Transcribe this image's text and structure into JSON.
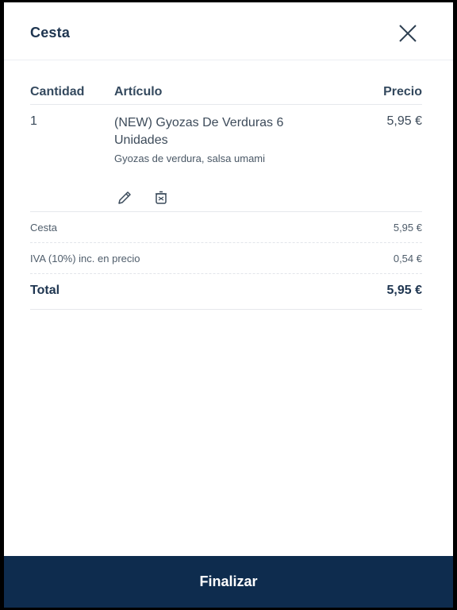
{
  "header": {
    "title": "Cesta",
    "close_icon": "close-icon"
  },
  "table": {
    "headers": {
      "qty": "Cantidad",
      "article": "Artículo",
      "price": "Precio"
    },
    "items": [
      {
        "qty": "1",
        "name": "(NEW) Gyozas De Verduras 6 Unidades",
        "description": "Gyozas de verdura, salsa umami",
        "price": "5,95 €",
        "edit_icon": "pencil-icon",
        "delete_icon": "trash-icon"
      }
    ]
  },
  "summary": {
    "subtotal_label": "Cesta",
    "subtotal_value": "5,95 €",
    "tax_label": "IVA (10%) inc. en precio",
    "tax_value": "0,54 €",
    "total_label": "Total",
    "total_value": "5,95 €"
  },
  "footer": {
    "checkout_label": "Finalizar"
  },
  "colors": {
    "primary": "#0e2c4e",
    "text": "#1e3550"
  }
}
